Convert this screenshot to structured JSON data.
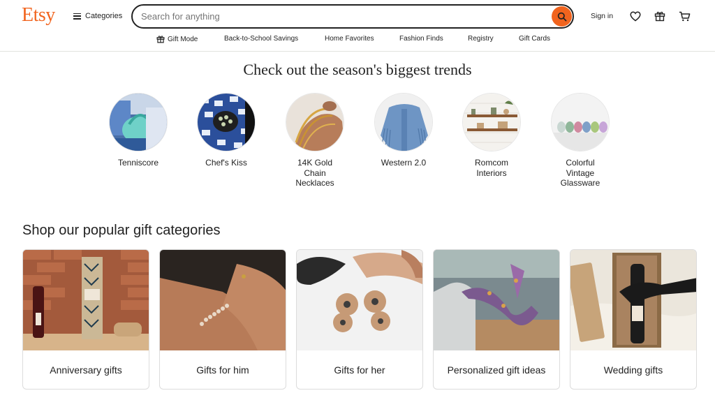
{
  "header": {
    "logo": "Etsy",
    "categories_label": "Categories",
    "search_placeholder": "Search for anything",
    "signin_label": "Sign in"
  },
  "subnav": {
    "gift_mode": "Gift Mode",
    "back_to_school": "Back-to-School Savings",
    "home_favorites": "Home Favorites",
    "fashion_finds": "Fashion Finds",
    "registry": "Registry",
    "gift_cards": "Gift Cards"
  },
  "trends": {
    "title": "Check out the season's biggest trends",
    "items": [
      {
        "label": "Tenniscore"
      },
      {
        "label": "Chef's Kiss"
      },
      {
        "label": "14K Gold Chain Necklaces"
      },
      {
        "label": "Western 2.0"
      },
      {
        "label": "Romcom Interiors"
      },
      {
        "label": "Colorful Vintage Glassware"
      }
    ]
  },
  "gifts": {
    "title": "Shop our popular gift categories",
    "items": [
      {
        "label": "Anniversary gifts"
      },
      {
        "label": "Gifts for him"
      },
      {
        "label": "Gifts for her"
      },
      {
        "label": "Personalized gift ideas"
      },
      {
        "label": "Wedding gifts"
      }
    ]
  },
  "colors": {
    "brand": "#F1641E",
    "text": "#222222",
    "border": "#dcdcdc"
  },
  "icons": [
    "hamburger-icon",
    "search-icon",
    "heart-icon",
    "gift-icon",
    "cart-icon"
  ]
}
